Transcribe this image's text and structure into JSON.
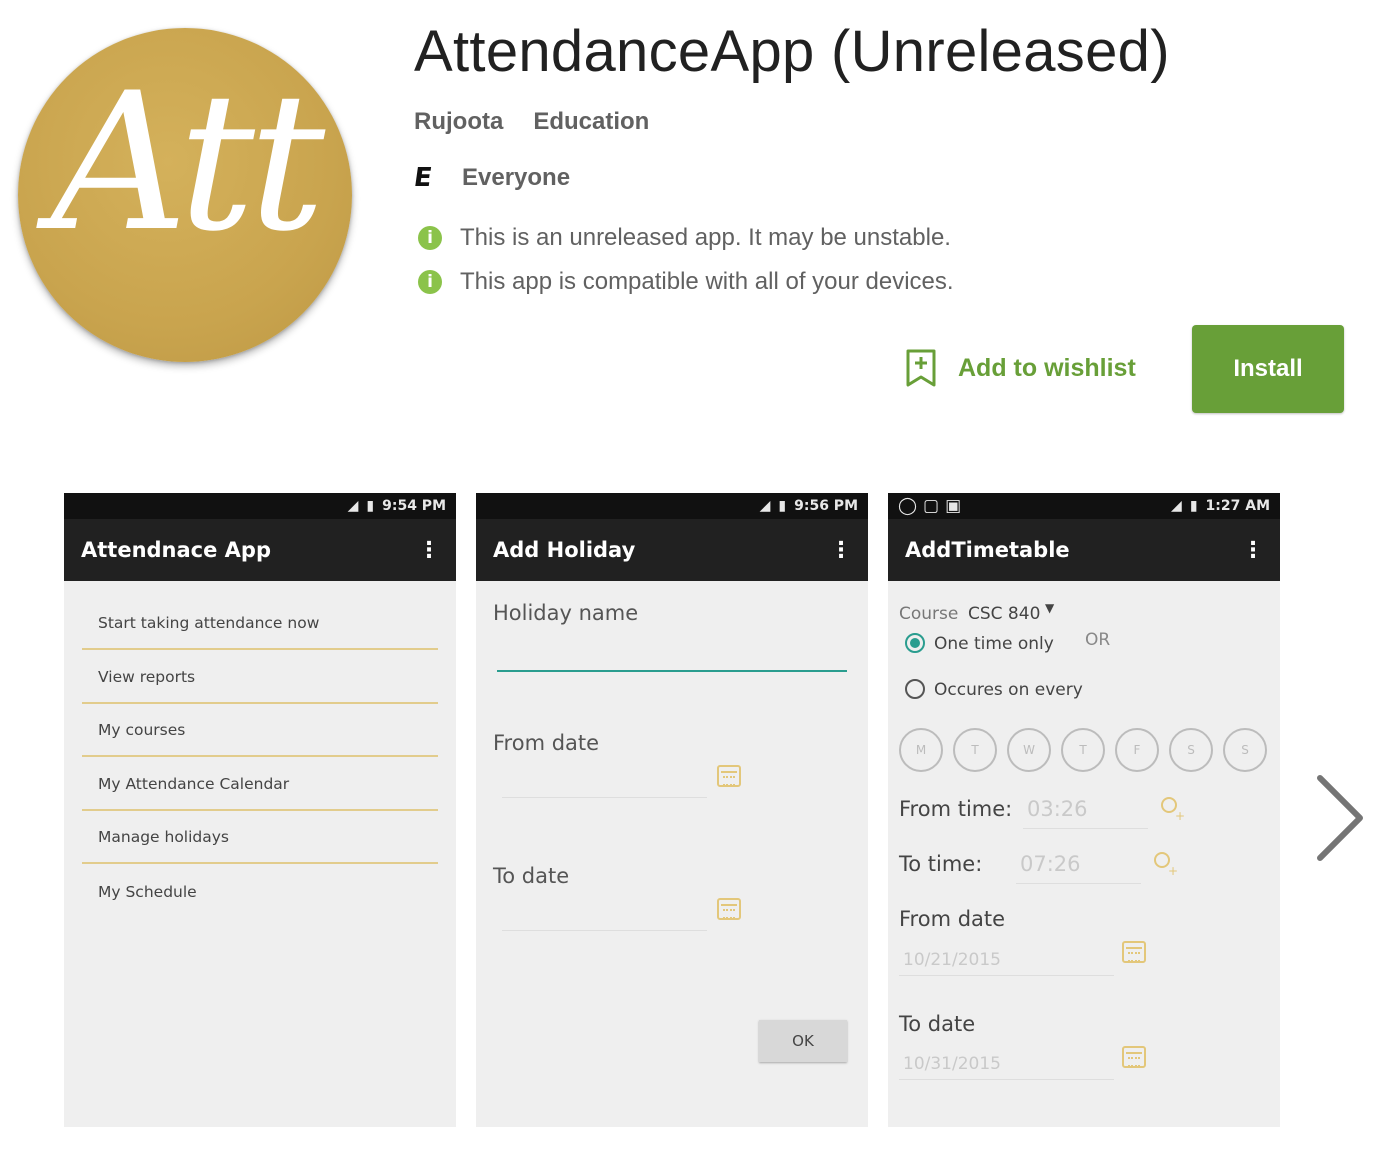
{
  "app": {
    "icon_text": "Att",
    "title": "AttendanceApp (Unreleased)",
    "developer": "Rujoota",
    "category": "Education",
    "content_rating_symbol": "E",
    "content_rating": "Everyone",
    "notices": [
      "This is an unreleased app. It may be unstable.",
      "This app is compatible with all of your devices."
    ],
    "wishlist_label": "Add to wishlist",
    "install_label": "Install",
    "accent_color": "#689f38",
    "notice_dot_color": "#8bc34a",
    "icon_color": "#c9a44e"
  },
  "screenshots": [
    {
      "time": "9:54 PM",
      "title": "Attendnace App",
      "menu_items": [
        "Start taking attendance now",
        "View reports",
        "My courses",
        "My Attendance Calendar",
        "Manage holidays",
        "My Schedule"
      ]
    },
    {
      "time": "9:56 PM",
      "title": "Add Holiday",
      "holiday_name_label": "Holiday name",
      "from_date_label": "From date",
      "to_date_label": "To date",
      "ok_label": "OK"
    },
    {
      "time": "1:27 AM",
      "title": "AddTimetable",
      "course_label": "Course",
      "course_value": "CSC 840",
      "option_one": "One time only",
      "or_label": "OR",
      "option_two": "Occures on every",
      "days": [
        "M",
        "T",
        "W",
        "T",
        "F",
        "S",
        "S"
      ],
      "from_time_label": "From time:",
      "from_time_value": "03:26",
      "to_time_label": "To time:",
      "to_time_value": "07:26",
      "from_date_label": "From date",
      "from_date_value": "10/21/2015",
      "to_date_label": "To date",
      "to_date_value": "10/31/2015"
    }
  ]
}
